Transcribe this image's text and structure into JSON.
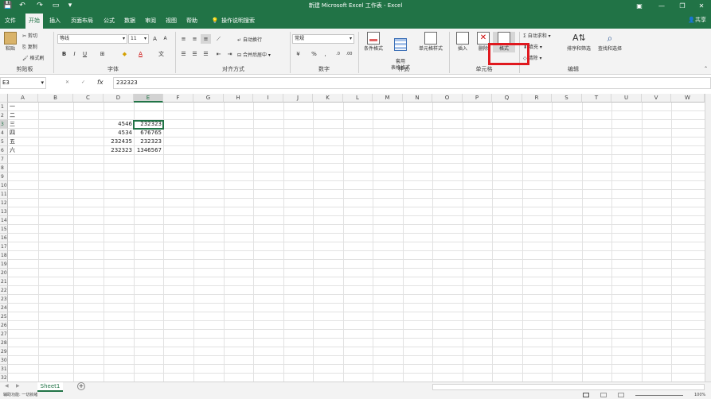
{
  "window": {
    "title": "新建 Microsoft Excel 工作表 - Excel",
    "share_label": "共享"
  },
  "qat": {
    "save": "💾",
    "undo": "↶",
    "redo": "↷",
    "customize": "▾"
  },
  "tabs": [
    "文件",
    "开始",
    "插入",
    "页面布局",
    "公式",
    "数据",
    "审阅",
    "视图",
    "帮助"
  ],
  "tell_me": "操作说明搜索",
  "ribbon": {
    "clipboard": {
      "paste": "粘贴",
      "cut": "剪切",
      "copy": "复制",
      "format_painter": "格式刷",
      "label": "剪贴板"
    },
    "font": {
      "name": "等线",
      "size": "11",
      "grow": "A",
      "shrink": "A",
      "bold": "B",
      "italic": "I",
      "underline": "U",
      "font_color": "A",
      "label": "字体"
    },
    "alignment": {
      "wrap": "自动换行",
      "merge": "合并后居中",
      "label": "对齐方式"
    },
    "number": {
      "format": "常规",
      "percent": "%",
      "comma": ",",
      "label": "数字"
    },
    "styles": {
      "conditional": "条件格式",
      "table": "套用\n表格格式",
      "cell_styles": "单元格样式",
      "label": "样式"
    },
    "cells": {
      "insert": "插入",
      "delete": "删除",
      "format": "格式",
      "label": "单元格"
    },
    "editing": {
      "autosum": "自动求和",
      "fill": "填充",
      "clear": "清除",
      "sort": "排序和筛选",
      "find": "查找和选择",
      "label": "编辑"
    }
  },
  "formula_bar": {
    "name_box": "E3",
    "fx": "fx",
    "value": "232323"
  },
  "columns": [
    "A",
    "B",
    "C",
    "D",
    "E",
    "F",
    "G",
    "H",
    "I",
    "J",
    "K",
    "L",
    "M",
    "N",
    "O",
    "P",
    "Q",
    "R",
    "S",
    "T",
    "U",
    "V",
    "W"
  ],
  "rows": [
    "1",
    "2",
    "3",
    "4",
    "5",
    "6",
    "7",
    "8",
    "9",
    "10",
    "11",
    "12",
    "13",
    "14",
    "15",
    "16",
    "17",
    "18",
    "19",
    "20",
    "21",
    "22",
    "23",
    "24",
    "25",
    "26",
    "27",
    "28",
    "29",
    "30",
    "31",
    "32"
  ],
  "cells": {
    "a1": "一",
    "a2": "二",
    "a3": "三",
    "a4": "四",
    "a5": "五",
    "a6": "六",
    "d3": "4546",
    "e3": "232323",
    "d4": "4534",
    "e4": "676765",
    "d5": "232435",
    "e5": "232323",
    "d6": "232323",
    "e6": "1346567"
  },
  "sheet_tab": "Sheet1",
  "add_sheet": "+",
  "status": "辅助功能: 一切就绪",
  "zoom": "100%",
  "colors": {
    "accent": "#217346",
    "highlight": "#e0191f"
  }
}
